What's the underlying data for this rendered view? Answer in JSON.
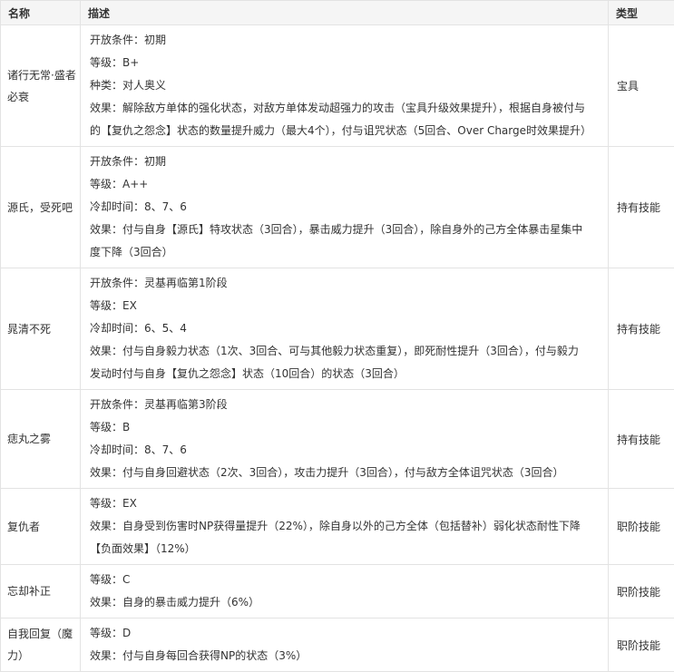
{
  "headers": {
    "name": "名称",
    "desc": "描述",
    "type": "类型"
  },
  "rows": [
    {
      "name": "诸行无常·盛者必衰",
      "lines": [
        "开放条件：初期",
        "等级：B+",
        "种类：对人奥义",
        "效果：解除敌方单体的强化状态，对敌方单体发动超强力的攻击（宝具升级效果提升），根据自身被付与",
        "的【复仇之怨念】状态的数量提升威力（最大4个），付与诅咒状态（5回合、Over Charge时效果提升）"
      ],
      "type": "宝具"
    },
    {
      "name": "源氏，受死吧",
      "lines": [
        "开放条件：初期",
        "等级：A++",
        "冷却时间：8、7、6",
        "效果：付与自身【源氏】特攻状态（3回合），暴击威力提升（3回合），除自身外的己方全体暴击星集中",
        "度下降（3回合）"
      ],
      "type": "持有技能"
    },
    {
      "name": "晁清不死",
      "lines": [
        "开放条件：灵基再临第1阶段",
        "等级：EX",
        "冷却时间：6、5、4",
        "效果：付与自身毅力状态（1次、3回合、可与其他毅力状态重复），即死耐性提升（3回合），付与毅力",
        "发动时付与自身【复仇之怨念】状态（10回合）的状态（3回合）"
      ],
      "type": "持有技能"
    },
    {
      "name": "痣丸之雾",
      "lines": [
        "开放条件：灵基再临第3阶段",
        "等级：B",
        "冷却时间：8、7、6",
        "效果：付与自身回避状态（2次、3回合），攻击力提升（3回合），付与敌方全体诅咒状态（3回合）"
      ],
      "type": "持有技能"
    },
    {
      "name": "复仇者",
      "lines": [
        "等级：EX",
        "效果：自身受到伤害时NP获得量提升（22%），除自身以外的己方全体（包括替补）弱化状态耐性下降",
        "【负面效果】（12%）"
      ],
      "type": "职阶技能"
    },
    {
      "name": "忘却补正",
      "lines": [
        "等级：C",
        "效果：自身的暴击威力提升（6%）"
      ],
      "type": "职阶技能"
    },
    {
      "name": "自我回复（魔力）",
      "lines": [
        "等级：D",
        "效果：付与自身每回合获得NP的状态（3%）"
      ],
      "type": "职阶技能"
    }
  ]
}
